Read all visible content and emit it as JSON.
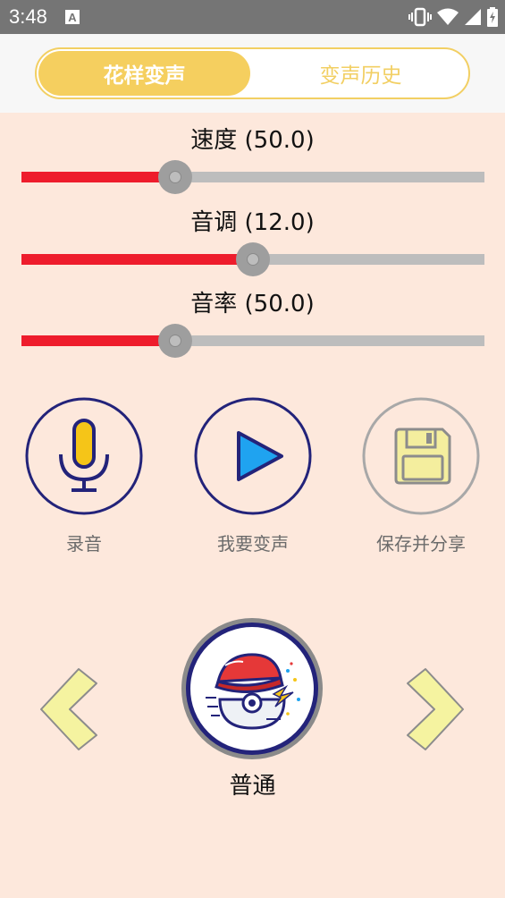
{
  "status_bar": {
    "time": "3:48",
    "icons": [
      "notification-a-icon",
      "vibrate-icon",
      "wifi-icon",
      "signal-icon",
      "battery-charging-icon"
    ]
  },
  "tabs": {
    "active_label": "花样变声",
    "inactive_label": "变声历史"
  },
  "sliders": [
    {
      "label": "速度 (50.0)",
      "value_fraction": 0.333
    },
    {
      "label": "音调 (12.0)",
      "value_fraction": 0.5
    },
    {
      "label": "音率 (50.0)",
      "value_fraction": 0.333
    }
  ],
  "actions": {
    "record_label": "录音",
    "play_label": "我要变声",
    "save_label": "保存并分享"
  },
  "effect": {
    "name": "普通"
  },
  "colors": {
    "accent_yellow": "#f5cf5f",
    "slider_fill": "#ee1c2c",
    "slider_track": "#bdbdbd",
    "circle_border": "#23237a",
    "background": "#fde8dc",
    "arrow_fill": "#f5f3a0"
  }
}
